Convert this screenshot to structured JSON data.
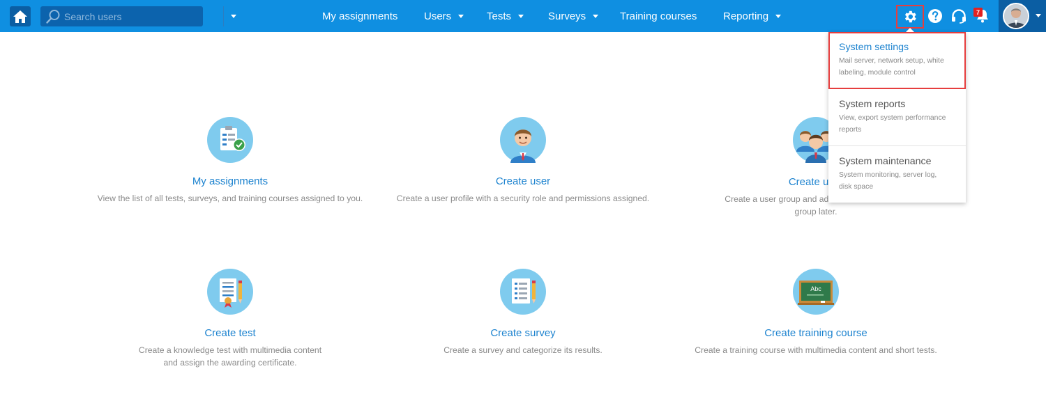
{
  "search": {
    "placeholder": "Search users"
  },
  "nav": {
    "my_assignments": "My assignments",
    "users": "Users",
    "tests": "Tests",
    "surveys": "Surveys",
    "training_courses": "Training courses",
    "reporting": "Reporting"
  },
  "notifications": {
    "count": "7"
  },
  "colors": {
    "topbar": "#0f8fe1",
    "accent": "#1d83cf",
    "highlight": "#e63e3e",
    "badge": "#e22121"
  },
  "tiles": [
    {
      "title": "My assignments",
      "desc": "View the list of all tests, surveys, and training courses assigned to you.",
      "icon": "clipboard-check-icon"
    },
    {
      "title": "Create user",
      "desc": "Create a user profile with a security role and permissions assigned.",
      "icon": "user-icon"
    },
    {
      "title": "Create user",
      "desc1": "Create a user group and add users to it.",
      "desc2": "group later.",
      "icon": "user-group-icon"
    },
    {
      "title": "Create test",
      "desc1": "Create a knowledge test with multimedia content",
      "desc2": "and assign the awarding certificate.",
      "icon": "test-certificate-icon"
    },
    {
      "title": "Create survey",
      "desc": "Create a survey and categorize its results.",
      "icon": "survey-icon"
    },
    {
      "title": "Create training course",
      "desc": "Create a training course with multimedia content and short tests.",
      "icon": "chalkboard-icon",
      "board_text": "Abc"
    }
  ],
  "settings_menu": [
    {
      "title": "System settings",
      "line1": "Mail server, network setup, white",
      "line2": "labeling, module control"
    },
    {
      "title": "System reports",
      "line1": "View, export system performance",
      "line2": "reports"
    },
    {
      "title": "System maintenance",
      "line1": "System monitoring, server log,",
      "line2": "disk space"
    }
  ]
}
